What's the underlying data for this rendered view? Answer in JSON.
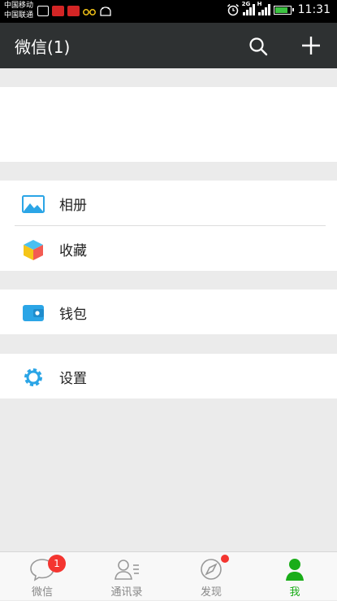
{
  "status_bar": {
    "carrier_1": "中国移动",
    "carrier_2": "中国联通",
    "network_2g": "2G",
    "network_h": "H",
    "time": "11:31",
    "battery_level_percent": 90
  },
  "header": {
    "title": "微信(1)",
    "search_icon": "search-icon",
    "add_icon": "plus-icon"
  },
  "menu": {
    "album": {
      "label": "相册",
      "icon": "album-icon",
      "color": "#2ba5e6"
    },
    "favorites": {
      "label": "收藏",
      "icon": "favorites-cube-icon"
    },
    "wallet": {
      "label": "钱包",
      "icon": "wallet-icon",
      "color": "#2ba5e6"
    },
    "settings": {
      "label": "设置",
      "icon": "gear-icon",
      "color": "#2ba5e6"
    }
  },
  "tabs": [
    {
      "label": "微信",
      "icon": "chat-bubble-icon",
      "badge": "1"
    },
    {
      "label": "通讯录",
      "icon": "contacts-icon"
    },
    {
      "label": "发现",
      "icon": "compass-icon",
      "has_dot": true
    },
    {
      "label": "我",
      "icon": "person-icon",
      "active": true
    }
  ],
  "colors": {
    "header_bg": "#2e3132",
    "active_tab": "#1aad19",
    "badge": "#f43530",
    "page_bg": "#ebebeb"
  }
}
